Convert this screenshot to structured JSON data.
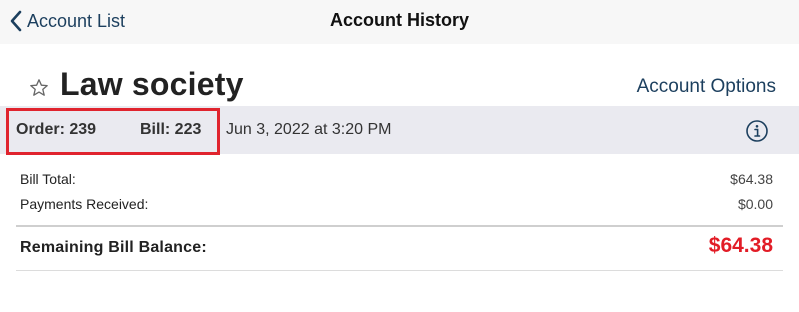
{
  "nav": {
    "back_label": "Account List",
    "title": "Account History"
  },
  "account": {
    "name": "Law society",
    "options_label": "Account Options",
    "favorite": false
  },
  "order_band": {
    "order": "Order: 239",
    "bill": "Bill: 223",
    "date": "Jun 3, 2022 at 3:20 PM"
  },
  "summary": {
    "rows": [
      {
        "label": "Bill Total:",
        "value": "$64.38"
      },
      {
        "label": "Payments Received:",
        "value": "$0.00"
      }
    ],
    "remaining_label": "Remaining Bill Balance:",
    "remaining_value": "$64.38"
  },
  "colors": {
    "accent": "#1c3f5e",
    "balance_due": "#e21c26",
    "highlight": "#e0242e",
    "band": "#eaeaf0"
  },
  "icons": {
    "back": "chevron-left-icon",
    "favorite": "star-outline-icon",
    "info": "info-circle-icon"
  }
}
